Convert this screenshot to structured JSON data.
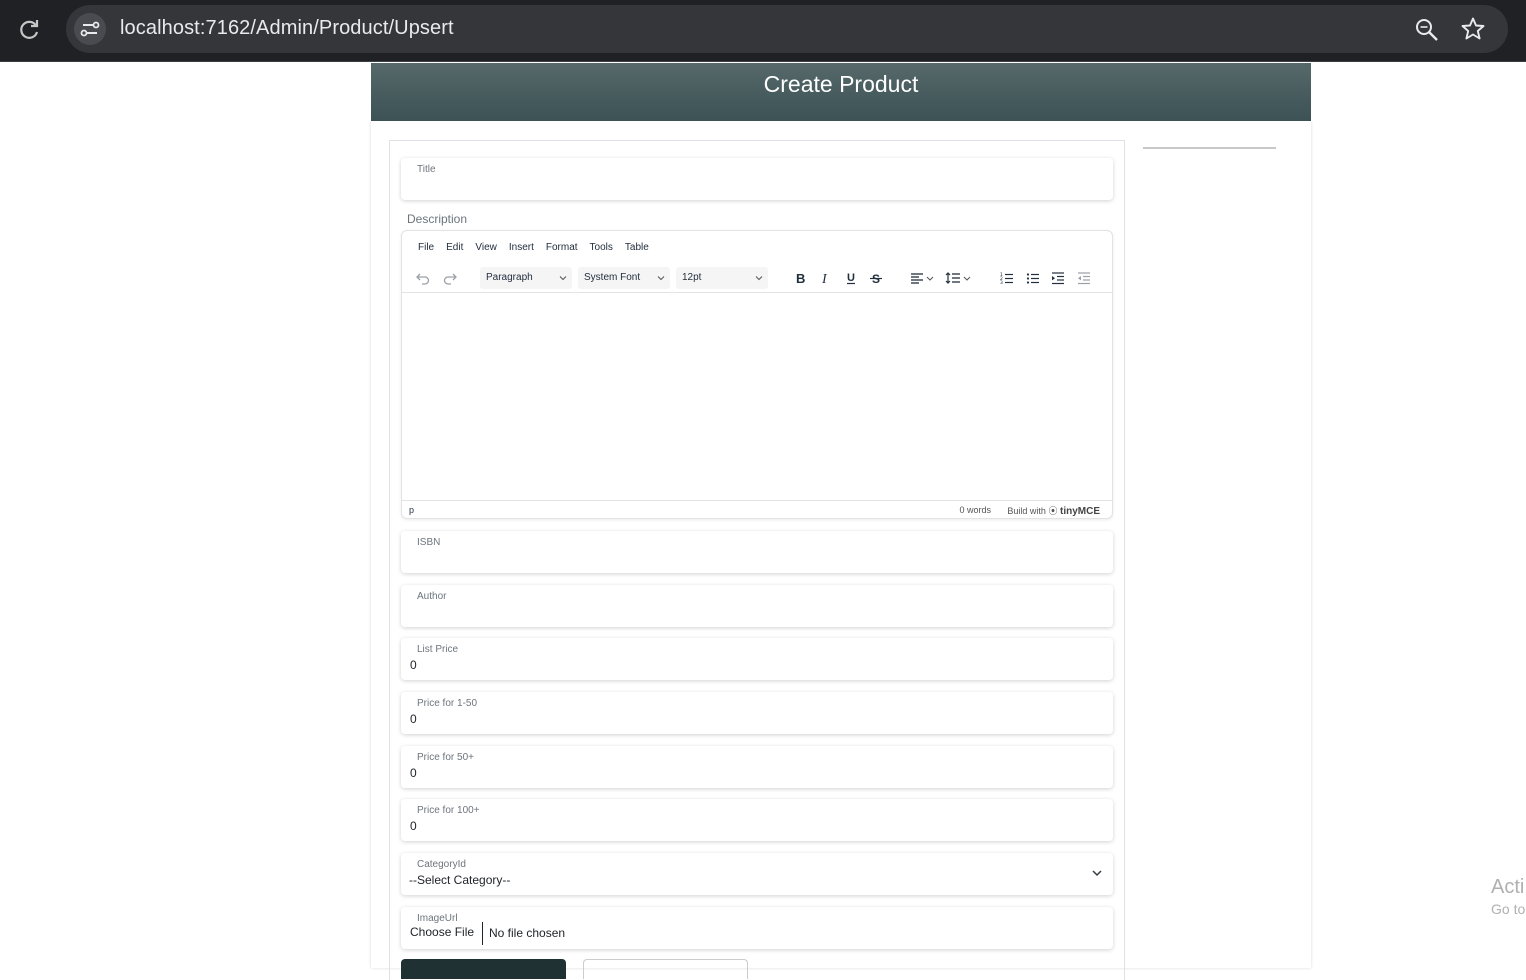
{
  "browser": {
    "url": "localhost:7162/Admin/Product/Upsert"
  },
  "header": {
    "title": "Create Product"
  },
  "form": {
    "title": {
      "label": "Title",
      "value": ""
    },
    "description_label": "Description",
    "editor": {
      "menu": [
        "File",
        "Edit",
        "View",
        "Insert",
        "Format",
        "Tools",
        "Table"
      ],
      "block_format": "Paragraph",
      "font_family": "System Font",
      "font_size": "12pt",
      "status_path": "p",
      "word_count": "0 words",
      "build_with": "Build with",
      "brand": "tinyMCE"
    },
    "isbn": {
      "label": "ISBN",
      "value": ""
    },
    "author": {
      "label": "Author",
      "value": ""
    },
    "list_price": {
      "label": "List Price",
      "value": "0"
    },
    "price_1_50": {
      "label": "Price for 1-50",
      "value": "0"
    },
    "price_50": {
      "label": "Price for 50+",
      "value": "0"
    },
    "price_100": {
      "label": "Price for 100+",
      "value": "0"
    },
    "category": {
      "label": "CategoryId",
      "selected": "--Select Category--"
    },
    "image": {
      "label": "ImageUrl",
      "button": "Choose File",
      "status": "No file chosen"
    }
  },
  "watermark": {
    "line1": "Acti",
    "line2": "Go to"
  }
}
